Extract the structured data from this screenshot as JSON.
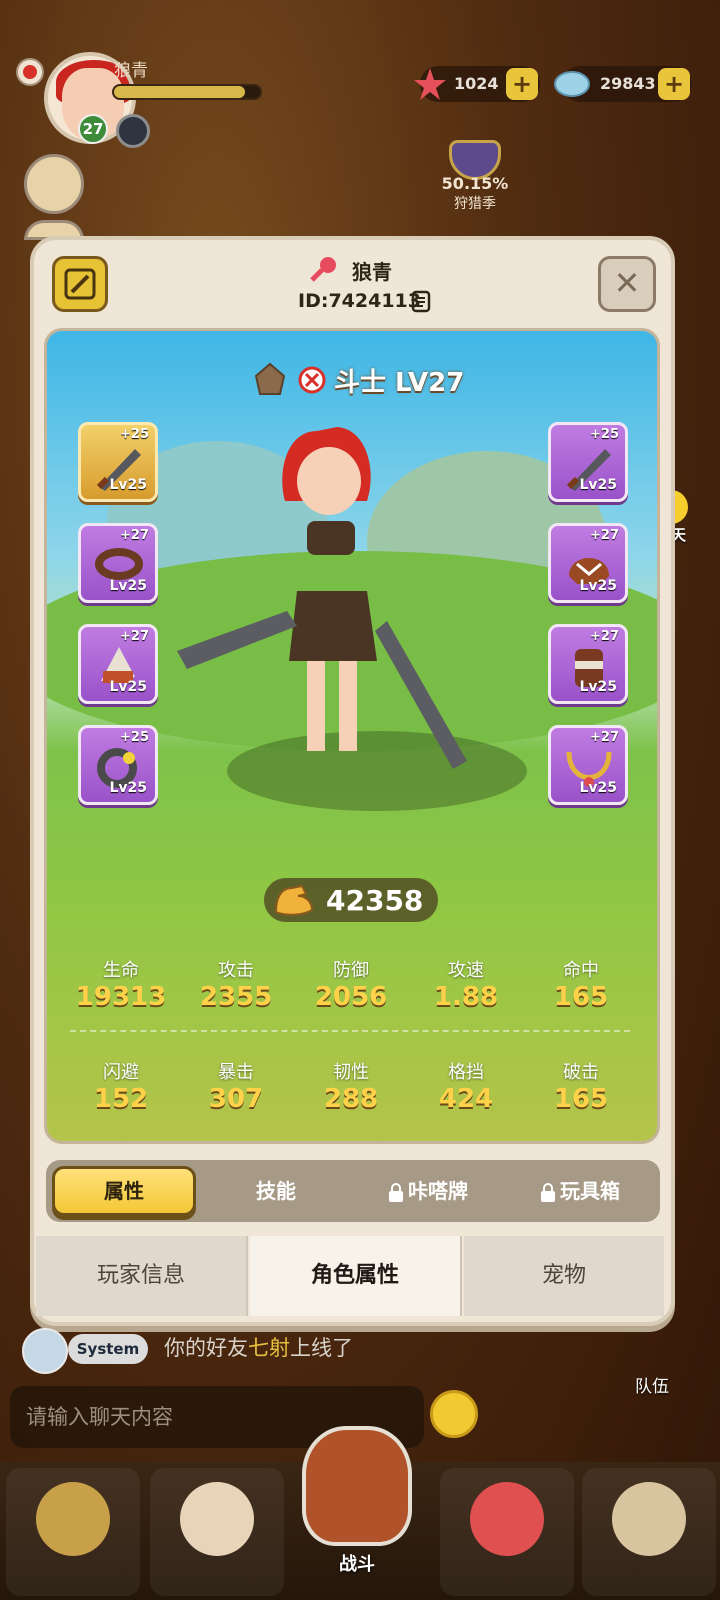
{
  "hud": {
    "player_name": "狼青",
    "level": "27",
    "exp_fraction": 0.9,
    "currency1": "1024",
    "currency2": "29843",
    "season_pct": "50.15%",
    "season_label": "狩猎季"
  },
  "profile": {
    "name": "狼青",
    "id": "ID:7424113",
    "class_label": "斗士 LV27",
    "power": "42358"
  },
  "equipment": {
    "left": [
      {
        "plus": "+25",
        "lv": "Lv25",
        "style": "gold",
        "icon": "sword-icon"
      },
      {
        "plus": "+27",
        "lv": "Lv25",
        "style": "purple",
        "icon": "bracelet-icon"
      },
      {
        "plus": "+27",
        "lv": "Lv25",
        "style": "purple",
        "icon": "shoulder-armor-icon"
      },
      {
        "plus": "+25",
        "lv": "Lv25",
        "style": "purple",
        "icon": "ring-icon"
      }
    ],
    "right": [
      {
        "plus": "+25",
        "lv": "Lv25",
        "style": "purple",
        "icon": "sword-icon"
      },
      {
        "plus": "+27",
        "lv": "Lv25",
        "style": "purple",
        "icon": "helmet-icon"
      },
      {
        "plus": "+27",
        "lv": "Lv25",
        "style": "purple",
        "icon": "gauntlet-icon"
      },
      {
        "plus": "+27",
        "lv": "Lv25",
        "style": "purple",
        "icon": "necklace-icon"
      }
    ]
  },
  "stats": {
    "row1": [
      {
        "k": "生命",
        "v": "19313"
      },
      {
        "k": "攻击",
        "v": "2355"
      },
      {
        "k": "防御",
        "v": "2056"
      },
      {
        "k": "攻速",
        "v": "1.88"
      },
      {
        "k": "命中",
        "v": "165"
      }
    ],
    "row2": [
      {
        "k": "闪避",
        "v": "152"
      },
      {
        "k": "暴击",
        "v": "307"
      },
      {
        "k": "韧性",
        "v": "288"
      },
      {
        "k": "格挡",
        "v": "424"
      },
      {
        "k": "破击",
        "v": "165"
      }
    ]
  },
  "subtabs": [
    "属性",
    "技能",
    "咔嗒牌",
    "玩具箱"
  ],
  "main_tabs": [
    "玩家信息",
    "角色属性",
    "宠物"
  ],
  "chat": {
    "system_label": "System",
    "msg_pre": "你的好友",
    "msg_hl": "七射",
    "msg_post": "上线了",
    "input_placeholder": "请输入聊天内容",
    "side_chat_label": "聊天",
    "team_label": "队伍"
  },
  "nav": {
    "fight_label": "战斗"
  },
  "colors": {
    "gold": "#ffd24a",
    "purple_slot": "#9a52c9",
    "tab_active": "#f4c836"
  }
}
